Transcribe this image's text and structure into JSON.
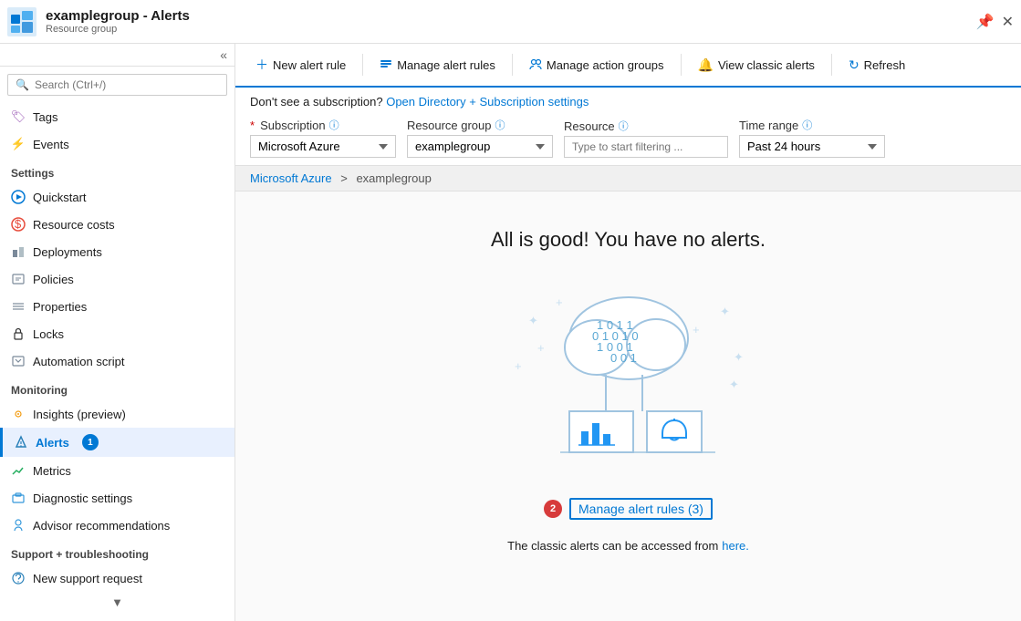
{
  "titlebar": {
    "title": "examplegroup - Alerts",
    "subtitle": "Resource group",
    "controls": [
      "pin-icon",
      "close-icon"
    ]
  },
  "sidebar": {
    "search_placeholder": "Search (Ctrl+/)",
    "collapse_label": "collapse",
    "items_top": [
      {
        "label": "Tags",
        "icon": "tag-icon",
        "color": "#9b59b6"
      },
      {
        "label": "Events",
        "icon": "events-icon",
        "color": "#f0c000"
      }
    ],
    "sections": [
      {
        "header": "Settings",
        "items": [
          {
            "label": "Quickstart",
            "icon": "quickstart-icon",
            "color": "#0078d4"
          },
          {
            "label": "Resource costs",
            "icon": "costs-icon",
            "color": "#e74c3c"
          },
          {
            "label": "Deployments",
            "icon": "deployments-icon",
            "color": "#7b8a9a"
          },
          {
            "label": "Policies",
            "icon": "policies-icon",
            "color": "#7b8a9a"
          },
          {
            "label": "Properties",
            "icon": "properties-icon",
            "color": "#7b8a9a"
          },
          {
            "label": "Locks",
            "icon": "locks-icon",
            "color": "#333"
          },
          {
            "label": "Automation script",
            "icon": "automation-icon",
            "color": "#7b8a9a"
          }
        ]
      },
      {
        "header": "Monitoring",
        "items": [
          {
            "label": "Insights (preview)",
            "icon": "insights-icon",
            "color": "#f39c12"
          },
          {
            "label": "Alerts",
            "icon": "alerts-icon",
            "color": "#2980b9",
            "active": true,
            "badge": "1"
          },
          {
            "label": "Metrics",
            "icon": "metrics-icon",
            "color": "#27ae60"
          },
          {
            "label": "Diagnostic settings",
            "icon": "diagnostic-icon",
            "color": "#3498db"
          },
          {
            "label": "Advisor recommendations",
            "icon": "advisor-icon",
            "color": "#3498db"
          }
        ]
      },
      {
        "header": "Support + troubleshooting",
        "items": [
          {
            "label": "New support request",
            "icon": "support-icon",
            "color": "#2980b9"
          }
        ]
      }
    ]
  },
  "toolbar": {
    "new_alert_rule": "New alert rule",
    "manage_alert_rules": "Manage alert rules",
    "manage_action_groups": "Manage action groups",
    "view_classic_alerts": "View classic alerts",
    "refresh": "Refresh"
  },
  "filter": {
    "notice": "Don't see a subscription?",
    "notice_link": "Open Directory + Subscription settings",
    "subscription_label": "Subscription",
    "subscription_value": "Microsoft Azure",
    "resource_group_label": "Resource group",
    "resource_group_value": "examplegroup",
    "resource_label": "Resource",
    "resource_placeholder": "Type to start filtering ...",
    "time_range_label": "Time range",
    "time_range_value": "Past 24 hours"
  },
  "breadcrumb": {
    "parent": "Microsoft Azure",
    "separator": ">",
    "current": "examplegroup"
  },
  "main": {
    "no_alerts_title": "All is good! You have no alerts.",
    "manage_link_badge": "2",
    "manage_link_text": "Manage alert rules (3)",
    "classic_text": "The classic alerts can be accessed from",
    "classic_link": "here."
  }
}
